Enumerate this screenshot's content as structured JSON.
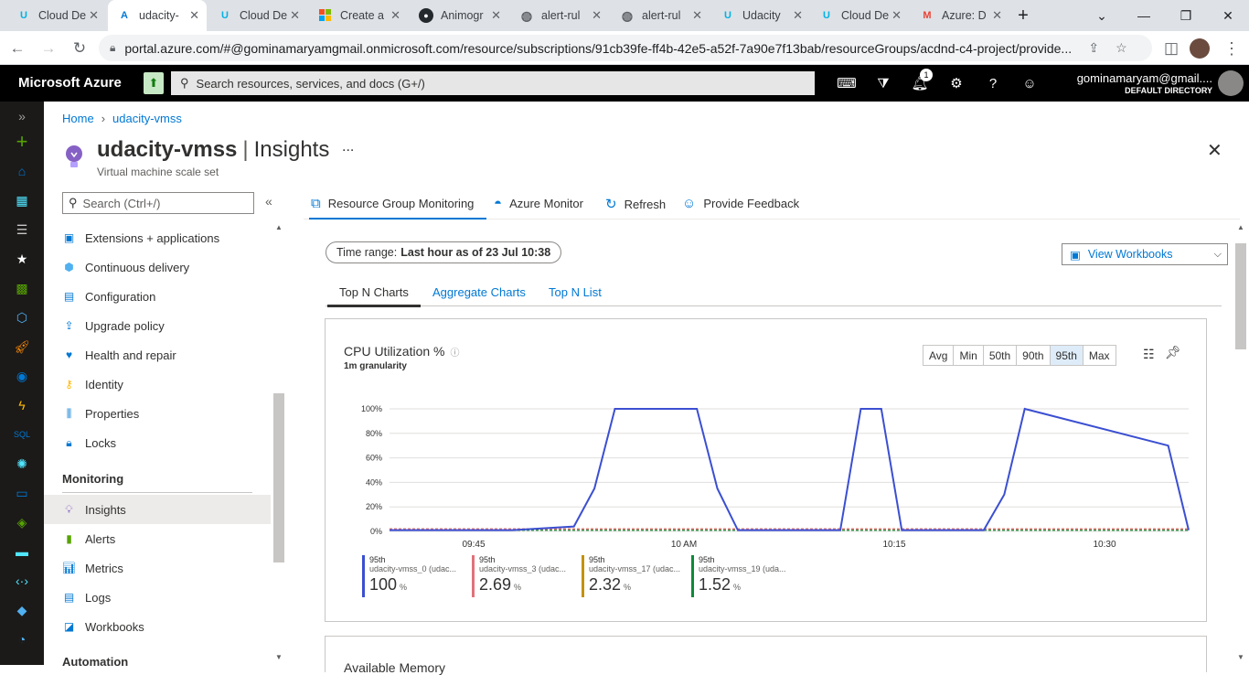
{
  "browser": {
    "tabs": [
      {
        "title": "Cloud De",
        "favicon": "udacity-icon"
      },
      {
        "title": "udacity-",
        "favicon": "azure-icon"
      },
      {
        "title": "Cloud De",
        "favicon": "udacity-icon"
      },
      {
        "title": "Create a",
        "favicon": "microsoft-icon"
      },
      {
        "title": "Animogr",
        "favicon": "github-icon"
      },
      {
        "title": "alert-rul",
        "favicon": "globe-icon"
      },
      {
        "title": "alert-rul",
        "favicon": "globe-icon"
      },
      {
        "title": "Udacity",
        "favicon": "udacity-icon"
      },
      {
        "title": "Cloud De",
        "favicon": "udacity-icon"
      },
      {
        "title": "Azure: D",
        "favicon": "gmail-icon"
      }
    ],
    "url": "portal.azure.com/#@gominamaryamgmail.onmicrosoft.com/resource/subscriptions/91cb39fe-ff4b-42e5-a52f-7a90e7f13bab/resourceGroups/acdnd-c4-project/provide..."
  },
  "portal": {
    "brand": "Microsoft Azure",
    "search_placeholder": "Search resources, services, and docs (G+/)",
    "notifications_count": "1",
    "user": "gominamaryam@gmail....",
    "directory": "DEFAULT DIRECTORY"
  },
  "breadcrumb": {
    "home": "Home",
    "resource": "udacity-vmss"
  },
  "blade": {
    "resource_name": "udacity-vmss",
    "section": "Insights",
    "subtitle": "Virtual machine scale set",
    "more": "...",
    "menu_search_placeholder": "Search (Ctrl+/)"
  },
  "menu": {
    "items_top": [
      {
        "label": "Extensions + applications",
        "icon": "extensions-icon"
      },
      {
        "label": "Continuous delivery",
        "icon": "continuous-delivery-icon"
      },
      {
        "label": "Configuration",
        "icon": "configuration-icon"
      },
      {
        "label": "Upgrade policy",
        "icon": "upgrade-policy-icon"
      },
      {
        "label": "Health and repair",
        "icon": "health-icon"
      },
      {
        "label": "Identity",
        "icon": "identity-icon"
      },
      {
        "label": "Properties",
        "icon": "properties-icon"
      },
      {
        "label": "Locks",
        "icon": "lock-icon"
      }
    ],
    "monitoring_header": "Monitoring",
    "items_monitoring": [
      {
        "label": "Insights",
        "icon": "insights-icon",
        "selected": true
      },
      {
        "label": "Alerts",
        "icon": "alerts-icon"
      },
      {
        "label": "Metrics",
        "icon": "metrics-icon"
      },
      {
        "label": "Logs",
        "icon": "logs-icon"
      },
      {
        "label": "Workbooks",
        "icon": "workbooks-icon"
      }
    ],
    "automation_header": "Automation"
  },
  "toolbar": {
    "resource_group_monitoring": "Resource Group Monitoring",
    "azure_monitor": "Azure Monitor",
    "refresh": "Refresh",
    "feedback": "Provide Feedback"
  },
  "time_range": {
    "label": "Time range:",
    "value": "Last hour as of 23 Jul 10:38"
  },
  "view_workbooks": "View Workbooks",
  "subtabs": {
    "top_n_charts": "Top N Charts",
    "aggregate_charts": "Aggregate Charts",
    "top_n_list": "Top N List"
  },
  "chart_card": {
    "title": "CPU Utilization %",
    "granularity": "1m granularity",
    "aggregations": [
      "Avg",
      "Min",
      "50th",
      "90th",
      "95th",
      "Max"
    ],
    "selected_aggregation": "95th"
  },
  "colors": {
    "blue": "#3b4fd1",
    "pink": "#e0727a",
    "gold": "#c39200",
    "green": "#0e8a3a",
    "azure": "#0078d4"
  },
  "chart_data": {
    "type": "line",
    "xlabels": [
      "09:45",
      "10 AM",
      "10:15",
      "10:30"
    ],
    "ylabels": [
      "100%",
      "80%",
      "60%",
      "40%",
      "20%",
      "0%"
    ],
    "ylim": [
      0,
      100
    ],
    "x_minutes": [
      0,
      6,
      9,
      10,
      11,
      12,
      15,
      16,
      17,
      18,
      21,
      22,
      23,
      24,
      25,
      29,
      30,
      31,
      38,
      39
    ],
    "series": [
      {
        "name": "udacity-vmss_0 (udac...",
        "color": "#3b4fd1",
        "values": [
          1,
          1,
          4,
          35,
          100,
          100,
          100,
          35,
          1,
          1,
          1,
          1,
          100,
          100,
          1,
          1,
          30,
          100,
          70,
          1
        ]
      },
      {
        "name": "udacity-vmss_3 (udac...",
        "color": "#e0727a",
        "values": [
          2,
          2,
          2,
          2,
          2,
          2,
          2,
          2,
          2,
          2,
          2,
          2,
          2,
          2,
          2,
          2,
          2,
          2,
          2,
          2
        ]
      },
      {
        "name": "udacity-vmss_17 (udac...",
        "color": "#c39200",
        "values": [
          2,
          2,
          2,
          2,
          2,
          2,
          2,
          2,
          2,
          2,
          2,
          2,
          2,
          2,
          2,
          2,
          2,
          2,
          2,
          2
        ]
      },
      {
        "name": "udacity-vmss_19 (uda...",
        "color": "#0e8a3a",
        "values": [
          1,
          1,
          1,
          1,
          1,
          1,
          1,
          1,
          1,
          1,
          1,
          1,
          1,
          1,
          1,
          1,
          1,
          1,
          1,
          1
        ]
      }
    ],
    "legend": [
      {
        "agg": "95th",
        "name": "udacity-vmss_0 (udac...",
        "value": "100",
        "unit": "%",
        "color": "#3b4fd1"
      },
      {
        "agg": "95th",
        "name": "udacity-vmss_3 (udac...",
        "value": "2.69",
        "unit": "%",
        "color": "#e0727a"
      },
      {
        "agg": "95th",
        "name": "udacity-vmss_17 (udac...",
        "value": "2.32",
        "unit": "%",
        "color": "#c39200"
      },
      {
        "agg": "95th",
        "name": "udacity-vmss_19 (uda...",
        "value": "1.52",
        "unit": "%",
        "color": "#0e8a3a"
      }
    ]
  },
  "next_card_title": "Available Memory"
}
